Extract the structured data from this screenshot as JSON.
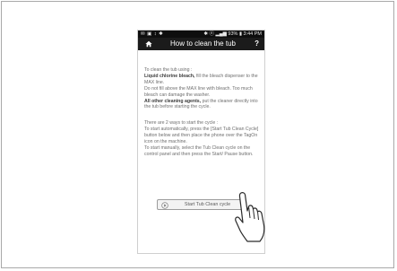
{
  "status_bar": {
    "left_icons": "✉ ▣ ↕ ✱",
    "right_text": "✱ ⓝ ▂▄▆ 93% ▮ 3:44 PM"
  },
  "title_bar": {
    "title": "How to clean the tub",
    "help_label": "?",
    "home_icon": "home-icon"
  },
  "instructions": {
    "intro": "To clean the tub using :",
    "bleach_label": "Liquid chlorine bleach,",
    "bleach_text": " fill the bleach dispenser to the MAX line.",
    "warning": "Do not fill above the MAX line with bleach. Too much bleach can damage the washer.",
    "other_label": "All other cleaning agents,",
    "other_text": " put the cleaner directly into the tub before starting the cycle.",
    "ways_heading": "There are 2 ways to start the cycle :",
    "auto_text": "To start automatically, press the [Start Tub Clean Cycle] button below and then place the phone over the TagOn icon on the machine.",
    "manual_text": "To start manually, select the Tub Clean cycle on the control panel and then press the Start/ Pause button."
  },
  "start_button": {
    "label": "Start Tub Clean cycle",
    "icon": "play-icon"
  },
  "pointer": {
    "icon": "hand-pointer-icon"
  },
  "colors": {
    "title_bar_bg": "#1b1b1b",
    "status_bar_bg": "#0e0e0e",
    "body_text": "#6e6e6e"
  }
}
